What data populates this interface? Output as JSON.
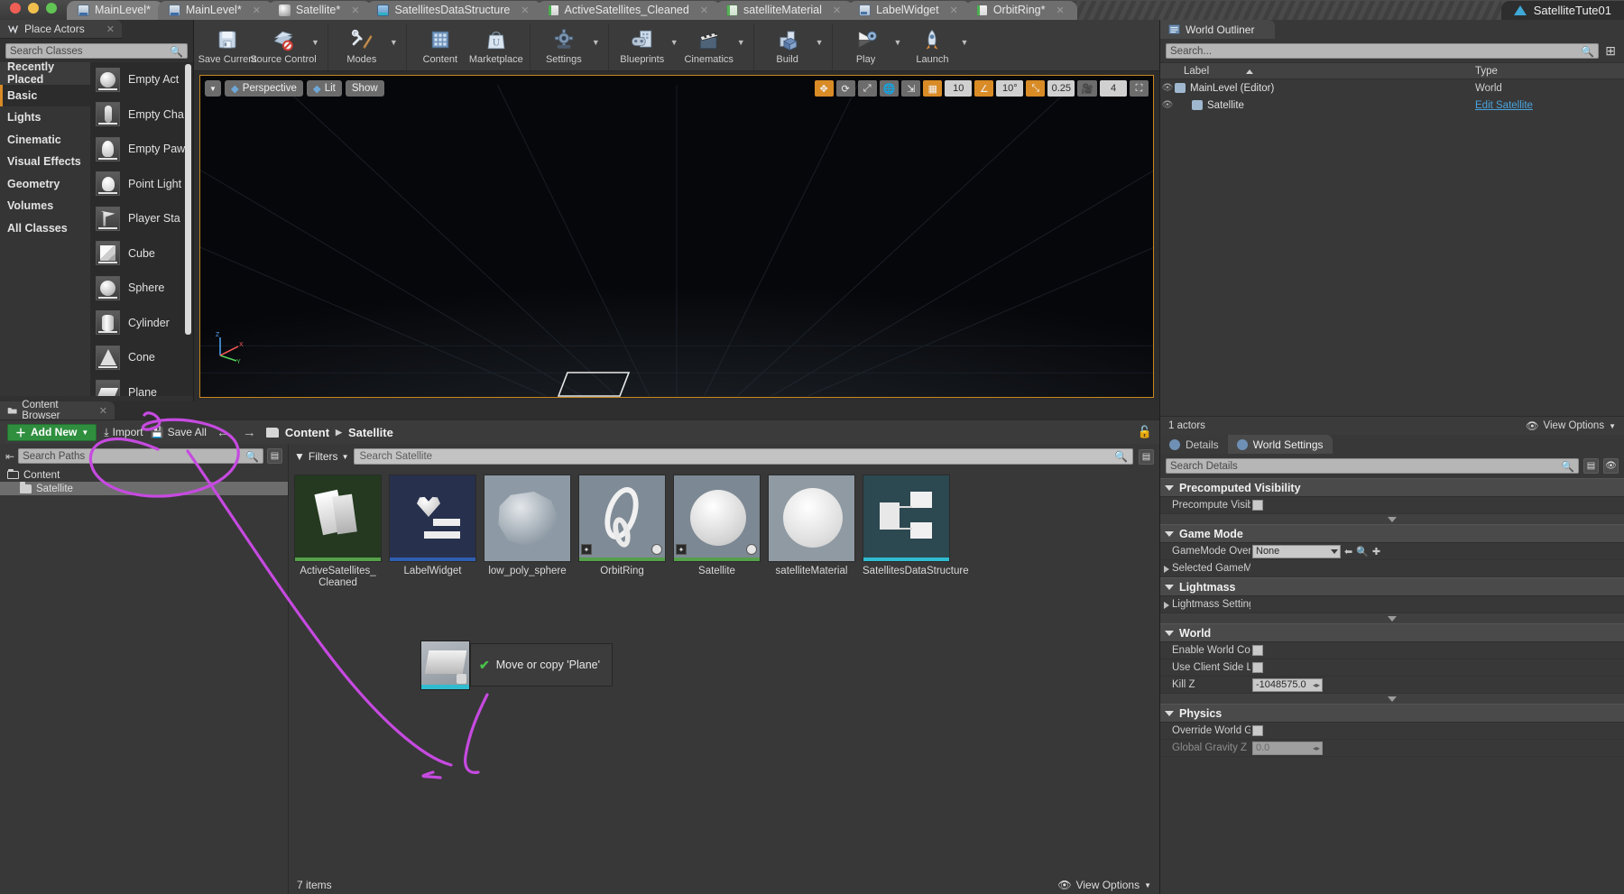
{
  "window": {
    "project_name": "SatelliteTute01",
    "traffic_lights": [
      "close",
      "minimize",
      "maximize"
    ]
  },
  "tabs": [
    {
      "label": "MainLevel*",
      "icon": "level-icon",
      "active": true,
      "closable": false
    },
    {
      "label": "MainLevel*",
      "icon": "level-icon",
      "active": false,
      "closable": true
    },
    {
      "label": "Satellite*",
      "icon": "sphere-icon",
      "active": false,
      "closable": true
    },
    {
      "label": "SatellitesDataStructure",
      "icon": "data-table-icon",
      "active": false,
      "closable": true
    },
    {
      "label": "ActiveSatellites_Cleaned",
      "icon": "csv-icon",
      "active": false,
      "closable": true
    },
    {
      "label": "satelliteMaterial",
      "icon": "material-icon",
      "active": false,
      "closable": true
    },
    {
      "label": "LabelWidget",
      "icon": "widget-icon",
      "active": false,
      "closable": true
    },
    {
      "label": "OrbitRing*",
      "icon": "blueprint-icon",
      "active": false,
      "closable": true
    }
  ],
  "toolbar": {
    "groups": [
      {
        "items": [
          {
            "label": "Save Current",
            "icon": "save-icon",
            "caret": false
          },
          {
            "label": "Source Control",
            "icon": "source-control-icon",
            "caret": true
          }
        ]
      },
      {
        "items": [
          {
            "label": "Modes",
            "icon": "modes-icon",
            "caret": true
          }
        ]
      },
      {
        "items": [
          {
            "label": "Content",
            "icon": "content-icon",
            "caret": false
          },
          {
            "label": "Marketplace",
            "icon": "marketplace-icon",
            "caret": false
          }
        ]
      },
      {
        "items": [
          {
            "label": "Settings",
            "icon": "settings-gear-icon",
            "caret": true
          }
        ]
      },
      {
        "items": [
          {
            "label": "Blueprints",
            "icon": "blueprints-icon",
            "caret": true
          },
          {
            "label": "Cinematics",
            "icon": "cinematics-icon",
            "caret": true
          }
        ]
      },
      {
        "items": [
          {
            "label": "Build",
            "icon": "build-icon",
            "caret": true
          }
        ]
      },
      {
        "items": [
          {
            "label": "Play",
            "icon": "play-icon",
            "caret": true
          },
          {
            "label": "Launch",
            "icon": "launch-icon",
            "caret": true
          }
        ]
      }
    ]
  },
  "place_actors": {
    "tab_label": "Place Actors",
    "tab_icon": "place-actors-icon",
    "search_placeholder": "Search Classes",
    "categories": [
      {
        "label": "Recently Placed",
        "selected": false,
        "hover": true
      },
      {
        "label": "Basic",
        "selected": true,
        "hover": false
      },
      {
        "label": "Lights",
        "selected": false,
        "hover": false
      },
      {
        "label": "Cinematic",
        "selected": false,
        "hover": false
      },
      {
        "label": "Visual Effects",
        "selected": false,
        "hover": false
      },
      {
        "label": "Geometry",
        "selected": false,
        "hover": false
      },
      {
        "label": "Volumes",
        "selected": false,
        "hover": false
      },
      {
        "label": "All Classes",
        "selected": false,
        "hover": false
      }
    ],
    "actors": [
      {
        "label": "Empty Act",
        "shape": "sphere-thumb"
      },
      {
        "label": "Empty Cha",
        "shape": "character-thumb"
      },
      {
        "label": "Empty Paw",
        "shape": "pawn-thumb"
      },
      {
        "label": "Point Light",
        "shape": "bulb-thumb"
      },
      {
        "label": "Player Sta",
        "shape": "flag-thumb"
      },
      {
        "label": "Cube",
        "shape": "cube-thumb"
      },
      {
        "label": "Sphere",
        "shape": "sphere-thumb"
      },
      {
        "label": "Cylinder",
        "shape": "cylinder-thumb"
      },
      {
        "label": "Cone",
        "shape": "cone-thumb"
      },
      {
        "label": "Plane",
        "shape": "plane-thumb"
      }
    ]
  },
  "viewport": {
    "left_buttons": [
      {
        "label": "Perspective",
        "icon": "camera-icon"
      },
      {
        "label": "Lit",
        "icon": "lit-icon"
      },
      {
        "label": "Show",
        "icon": ""
      }
    ],
    "right_controls": [
      {
        "name": "transform-move",
        "text": "",
        "icon": "move-gizmo-icon",
        "active": true
      },
      {
        "name": "transform-rotate",
        "text": "",
        "icon": "rotate-gizmo-icon",
        "active": false
      },
      {
        "name": "transform-scale",
        "text": "",
        "icon": "scale-gizmo-icon",
        "active": false
      },
      {
        "name": "world-space",
        "text": "",
        "icon": "globe-icon",
        "active": false
      },
      {
        "name": "surface-snap",
        "text": "",
        "icon": "surface-snap-icon",
        "active": false
      },
      {
        "name": "grid-snap-toggle",
        "text": "",
        "icon": "grid-icon",
        "active": true
      },
      {
        "name": "grid-snap-value",
        "text": "10",
        "icon": "",
        "active": false
      },
      {
        "name": "rotation-snap-toggle",
        "text": "",
        "icon": "angle-icon",
        "active": true
      },
      {
        "name": "rotation-snap-value",
        "text": "10°",
        "icon": "",
        "active": false
      },
      {
        "name": "scale-snap-toggle",
        "text": "",
        "icon": "scale-snap-icon",
        "active": true
      },
      {
        "name": "scale-snap-value",
        "text": "0.25",
        "icon": "",
        "active": false
      },
      {
        "name": "camera-speed-toggle",
        "text": "",
        "icon": "camera-speed-icon",
        "active": false
      },
      {
        "name": "camera-speed-value",
        "text": "4",
        "icon": "",
        "active": false
      },
      {
        "name": "maximize-viewport",
        "text": "",
        "icon": "maximize-icon",
        "active": false
      }
    ],
    "gizmo_axes": [
      "X",
      "Y",
      "Z"
    ]
  },
  "world_outliner": {
    "tab_label": "World Outliner",
    "tab_icon": "world-outliner-icon",
    "search_placeholder": "Search...",
    "columns": [
      "Label",
      "Type"
    ],
    "rows": [
      {
        "label": "MainLevel (Editor)",
        "type": "World",
        "type_link": false,
        "indent": 0,
        "icon": "world-icon"
      },
      {
        "label": "Satellite",
        "type": "Edit Satellite",
        "type_link": true,
        "indent": 1,
        "icon": "actor-icon"
      }
    ],
    "status": "1 actors",
    "view_options": "View Options"
  },
  "details": {
    "tabs": [
      {
        "label": "Details",
        "icon": "details-icon",
        "active": false
      },
      {
        "label": "World Settings",
        "icon": "world-settings-icon",
        "active": true
      }
    ],
    "search_placeholder": "Search Details",
    "sections": [
      {
        "title": "Precomputed Visibility",
        "rows": [
          {
            "name": "Precompute Visibility",
            "type": "checkbox",
            "value": "",
            "dim": false
          }
        ],
        "has_expander": true
      },
      {
        "title": "Game Mode",
        "rows": [
          {
            "name": "GameMode Override",
            "type": "combo",
            "value": "None",
            "dim": false
          },
          {
            "name": "Selected GameMode",
            "type": "expand",
            "value": "",
            "dim": false
          }
        ],
        "has_expander": false
      },
      {
        "title": "Lightmass",
        "rows": [
          {
            "name": "Lightmass Settings",
            "type": "expand",
            "value": "",
            "dim": false
          }
        ],
        "has_expander": true
      },
      {
        "title": "World",
        "rows": [
          {
            "name": "Enable World Composition",
            "type": "checkbox",
            "value": "",
            "dim": false
          },
          {
            "name": "Use Client Side Level",
            "type": "checkbox",
            "value": "",
            "dim": false
          },
          {
            "name": "Kill Z",
            "type": "number",
            "value": "-1048575.0",
            "dim": false
          }
        ],
        "has_expander": true
      },
      {
        "title": "Physics",
        "rows": [
          {
            "name": "Override World Gravity",
            "type": "checkbox",
            "value": "",
            "dim": false
          },
          {
            "name": "Global Gravity Z",
            "type": "number",
            "value": "0.0",
            "dim": true
          }
        ],
        "has_expander": false
      }
    ]
  },
  "content_browser": {
    "tab_label": "Content Browser",
    "tab_icon": "content-browser-icon",
    "add_new_label": "Add New",
    "import_label": "Import",
    "save_all_label": "Save All",
    "breadcrumbs": [
      "Content",
      "Satellite"
    ],
    "paths_search_placeholder": "Search Paths",
    "tree": [
      {
        "label": "Content",
        "indent": 0,
        "selected": false,
        "open": true
      },
      {
        "label": "Satellite",
        "indent": 1,
        "selected": true,
        "open": false
      }
    ],
    "filters_label": "Filters",
    "asset_search_placeholder": "Search Satellite",
    "assets": [
      {
        "label": "ActiveSatellites_\nCleaned",
        "bg": "#24391f",
        "strip": "#55a04a",
        "shape": "csv-sheets"
      },
      {
        "label": "LabelWidget",
        "bg": "#27304d",
        "strip": "#2f5fb0",
        "shape": "widget-heart"
      },
      {
        "label": "low_poly_sphere",
        "bg": "#8d9aa6",
        "strip": "#8d9aa6",
        "shape": "poly-sphere"
      },
      {
        "label": "OrbitRing",
        "bg": "#7f8b96",
        "strip": "#55a04a",
        "shape": "orbit-ring",
        "badges": [
          "bp",
          "dot"
        ]
      },
      {
        "label": "Satellite",
        "bg": "#7c8893",
        "strip": "#55a04a",
        "shape": "satellite-ball",
        "badges": [
          "bp",
          "dot"
        ]
      },
      {
        "label": "satelliteMaterial",
        "bg": "#8f9aa3",
        "strip": "#8f9aa3",
        "shape": "material-ball"
      },
      {
        "label": "SatellitesDataStructure",
        "bg": "#2c4850",
        "strip": "#30bcd0",
        "shape": "data-struct"
      }
    ],
    "item_count": "7 items",
    "view_options": "View Options"
  },
  "drag_tooltip": {
    "text": "Move or copy 'Plane'",
    "icon": "check-icon"
  }
}
